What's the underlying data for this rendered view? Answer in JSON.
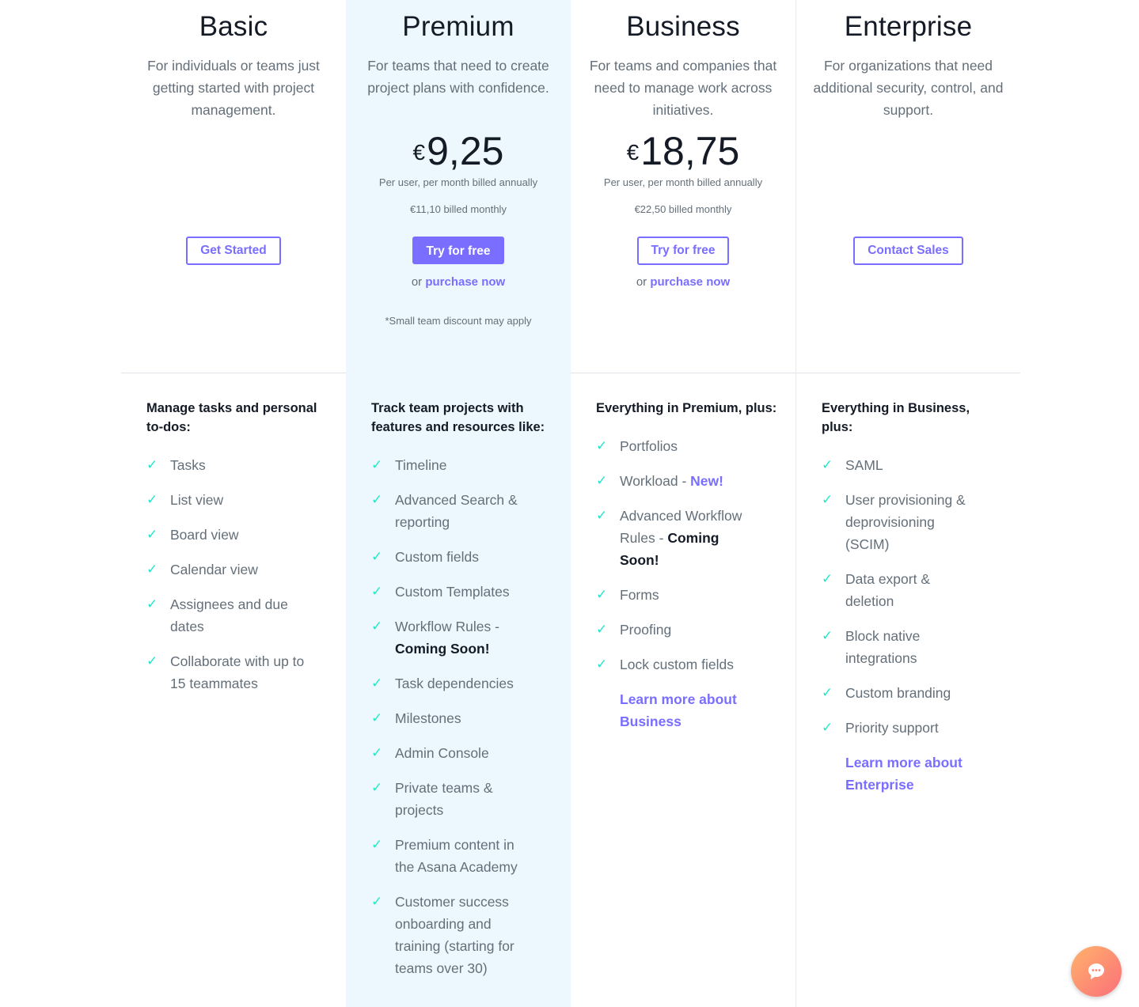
{
  "plans": [
    {
      "name": "Basic",
      "desc": "For individuals or teams just getting started with project management.",
      "button": "Get Started",
      "features_title": "Manage tasks and personal to-dos:",
      "features": [
        "Tasks",
        "List view",
        "Board view",
        "Calendar view",
        "Assignees and due dates",
        "Collaborate with up to 15 teammates"
      ]
    },
    {
      "name": "Premium",
      "desc": "For teams that need to create project plans with confidence.",
      "price_currency": "€",
      "price_amount": "9,25",
      "billed_annually": "Per user, per month billed annually",
      "billed_monthly": "€11,10 billed monthly",
      "button": "Try for free",
      "or_text": "or",
      "purchase_link": "purchase now",
      "discount": "*Small team discount may apply",
      "features_title": "Track team projects with features and resources like:",
      "features": [
        "Timeline",
        "Advanced Search & reporting",
        "Custom fields",
        "Custom Templates"
      ],
      "feature_workflow_text": "Workflow Rules -",
      "feature_workflow_bold": "Coming Soon!",
      "features_more": [
        "Task dependencies",
        "Milestones",
        "Admin Console",
        "Private teams & projects",
        "Premium content in the Asana Academy",
        "Customer success onboarding and training (starting for teams over 30)"
      ]
    },
    {
      "name": "Business",
      "desc": "For teams and companies that need to manage work across initiatives.",
      "price_currency": "€",
      "price_amount": "18,75",
      "billed_annually": "Per user, per month billed annually",
      "billed_monthly": "€22,50 billed monthly",
      "button": "Try for free",
      "or_text": "or",
      "purchase_link": "purchase now",
      "features_title": "Everything in Premium, plus:",
      "feature_portfolios": "Portfolios",
      "feature_workload_text": "Workload -",
      "feature_workload_new": "New!",
      "feature_awr_text": "Advanced Workflow Rules -",
      "feature_awr_bold": "Coming Soon!",
      "features_more": [
        "Forms",
        "Proofing",
        "Lock custom fields"
      ],
      "learn_more": "Learn more about Business"
    },
    {
      "name": "Enterprise",
      "desc": "For organizations that need additional security, control, and support.",
      "button": "Contact Sales",
      "features_title": "Everything in Business, plus:",
      "features": [
        "SAML",
        "User provisioning & deprovisioning (SCIM)",
        "Data export & deletion",
        "Block native integrations",
        "Custom branding",
        "Priority support"
      ],
      "learn_more": "Learn more about Enterprise"
    }
  ],
  "colors": {
    "accent": "#796eff",
    "check": "#25e8c8",
    "premium_bg": "#ecf8fd"
  },
  "check_icon": "✓",
  "chat_icon": "chat-bubble-icon"
}
